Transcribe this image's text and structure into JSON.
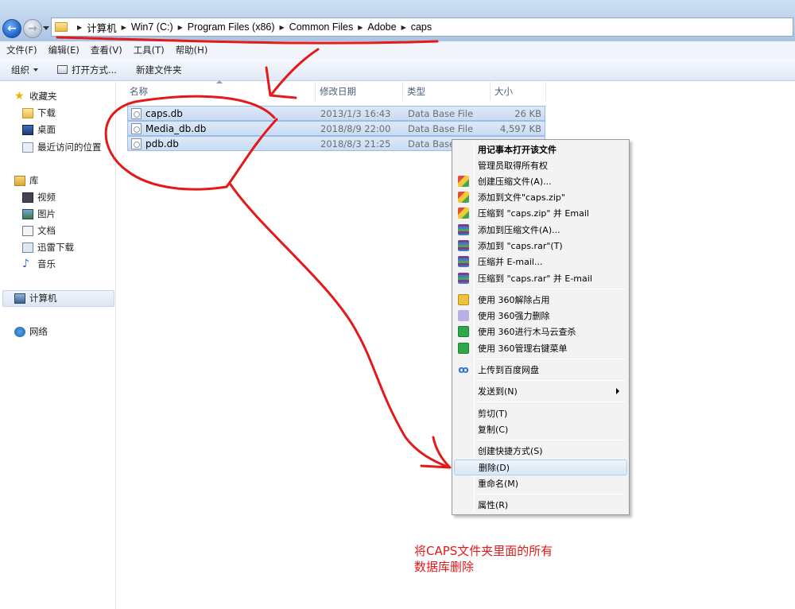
{
  "address": {
    "crumbs": [
      "计算机",
      "Win7 (C:)",
      "Program Files (x86)",
      "Common Files",
      "Adobe",
      "caps"
    ]
  },
  "menubar": {
    "file": "文件(F)",
    "edit": "编辑(E)",
    "view": "查看(V)",
    "tools": "工具(T)",
    "help": "帮助(H)"
  },
  "toolbar": {
    "organize": "组织",
    "open_with": "打开方式...",
    "new_folder": "新建文件夹"
  },
  "sidebar": {
    "favorites": "收藏夹",
    "downloads": "下载",
    "desktop": "桌面",
    "recent": "最近访问的位置",
    "libraries": "库",
    "videos": "视频",
    "pictures": "图片",
    "documents": "文档",
    "thunder": "迅雷下载",
    "music": "音乐",
    "computer": "计算机",
    "network": "网络"
  },
  "columns": {
    "name": "名称",
    "modified": "修改日期",
    "type": "类型",
    "size": "大小"
  },
  "files": [
    {
      "name": "caps.db",
      "modified": "2013/1/3 16:43",
      "type": "Data Base File",
      "size": "26 KB"
    },
    {
      "name": "Media_db.db",
      "modified": "2018/8/9 22:00",
      "type": "Data Base File",
      "size": "4,597 KB"
    },
    {
      "name": "pdb.db",
      "modified": "2018/8/3 21:25",
      "type": "Data Base"
    }
  ],
  "context_menu": {
    "open_notepad": "用记事本打开该文件",
    "take_ownership": "管理员取得所有权",
    "create_archive": "创建压缩文件(A)...",
    "add_to_zip": "添加到文件\"caps.zip\"",
    "zip_email": "压缩到 \"caps.zip\" 并 Email",
    "add_archive": "添加到压缩文件(A)...",
    "add_to_rar": "添加到 \"caps.rar\"(T)",
    "compress_email": "压缩并 E-mail...",
    "rar_email": "压缩到 \"caps.rar\" 并 E-mail",
    "unlock_360": "使用 360解除占用",
    "force_delete_360": "使用 360强力删除",
    "scan_360": "使用 360进行木马云查杀",
    "manage_360": "使用 360管理右键菜单",
    "baidu_upload": "上传到百度网盘",
    "send_to": "发送到(N)",
    "cut": "剪切(T)",
    "copy": "复制(C)",
    "create_shortcut": "创建快捷方式(S)",
    "delete": "删除(D)",
    "rename": "重命名(M)",
    "properties": "属性(R)"
  },
  "annotation": {
    "line1": "将CAPS文件夹里面的所有",
    "line2": "数据库删除",
    "color": "#e3191a"
  }
}
